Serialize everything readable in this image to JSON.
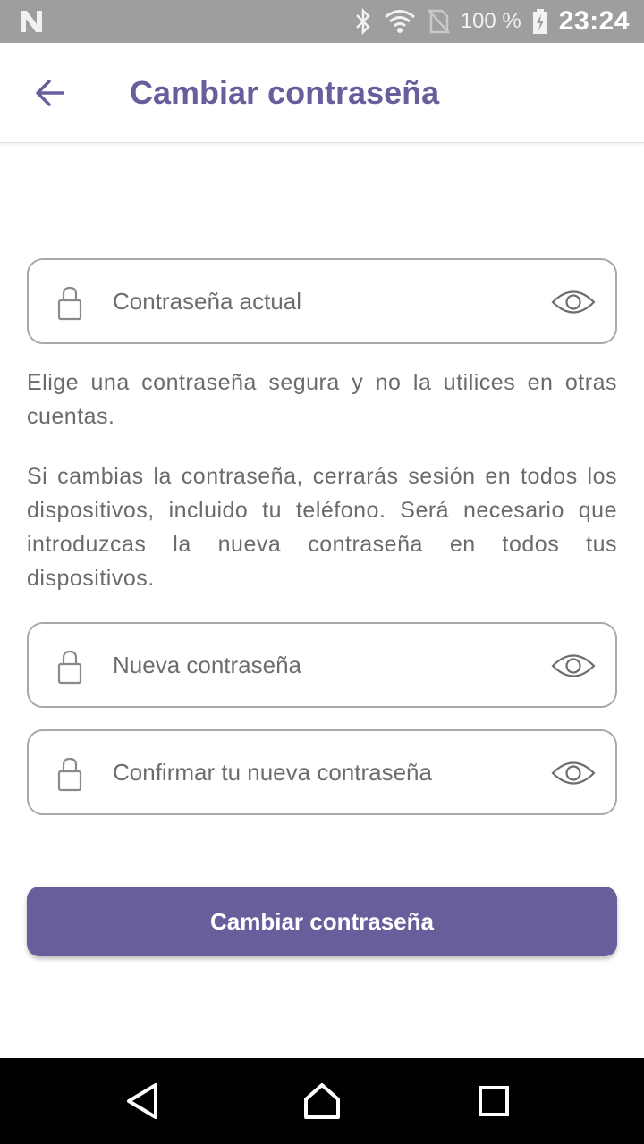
{
  "status_bar": {
    "left_icon": "n-notification-icon",
    "icons": [
      "bluetooth-icon",
      "wifi-icon",
      "no-sim-icon",
      "battery-charging-icon"
    ],
    "battery": "100 %",
    "time": "23:24"
  },
  "app_bar": {
    "back_icon": "arrow-left-icon",
    "title": "Cambiar contraseña"
  },
  "form": {
    "current_password": {
      "placeholder": "Contraseña actual",
      "value": ""
    },
    "hint_1": "Elige una contraseña segura y no la utilices en otras cuentas.",
    "hint_2": "Si cambias la contraseña, cerrarás sesión en todos los dispositivos, incluido tu teléfono. Será necesario que introduzcas la nueva contraseña en todos tus dispositivos.",
    "new_password": {
      "placeholder": "Nueva contraseña",
      "value": ""
    },
    "confirm_password": {
      "placeholder": "Confirmar tu nueva contraseña",
      "value": ""
    },
    "submit_label": "Cambiar contraseña"
  },
  "nav_bar": {
    "buttons": [
      "back-triangle-icon",
      "home-icon",
      "recents-square-icon"
    ]
  },
  "colors": {
    "accent": "#6a5d9c",
    "status_bar_bg": "#9e9e9e",
    "nav_bar_bg": "#000000",
    "field_border": "#a8a8a8",
    "body_text": "#6b6b6b"
  }
}
